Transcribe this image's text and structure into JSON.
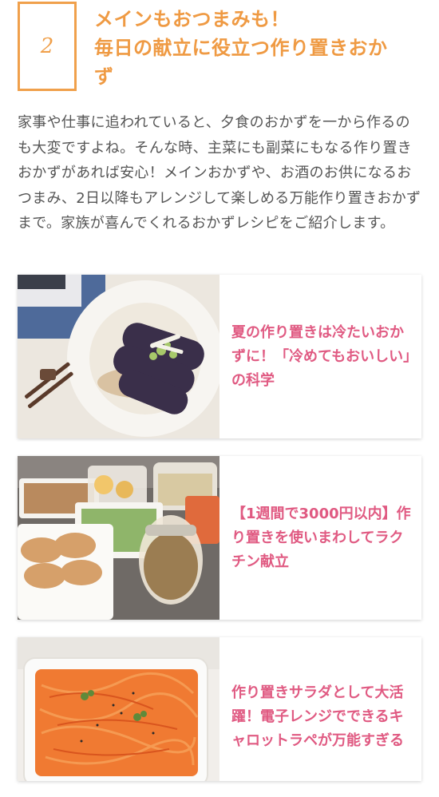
{
  "section": {
    "number": "2",
    "title_line1": "メインもおつまみも！",
    "title_line2": "毎日の献立に役立つ作り置きおか",
    "title_line3": "ず",
    "intro": "家事や仕事に追われていると、夕食のおかずを一から作るのも大変ですよね。そんな時、主菜にも副菜にもなる作り置きおかずがあれば安心！メインおかずや、お酒のお供になるおつまみ、2日以降もアレンジして楽しめる万能作り置きおかずまで。家族が喜んでくれるおかずレシピをご紹介します。"
  },
  "articles": [
    {
      "title": "夏の作り置きは冷たいおかずに！「冷めてもおいしい」の科学"
    },
    {
      "title": "【1週間で3000円以内】作り置きを使いまわしてラクチン献立"
    },
    {
      "title": "作り置きサラダとして大活躍！電子レンジでできるキャロットラペが万能すぎる"
    }
  ],
  "colors": {
    "accent_orange": "#ef9a43",
    "title_pink": "#e05a82",
    "body_text": "#555555"
  }
}
